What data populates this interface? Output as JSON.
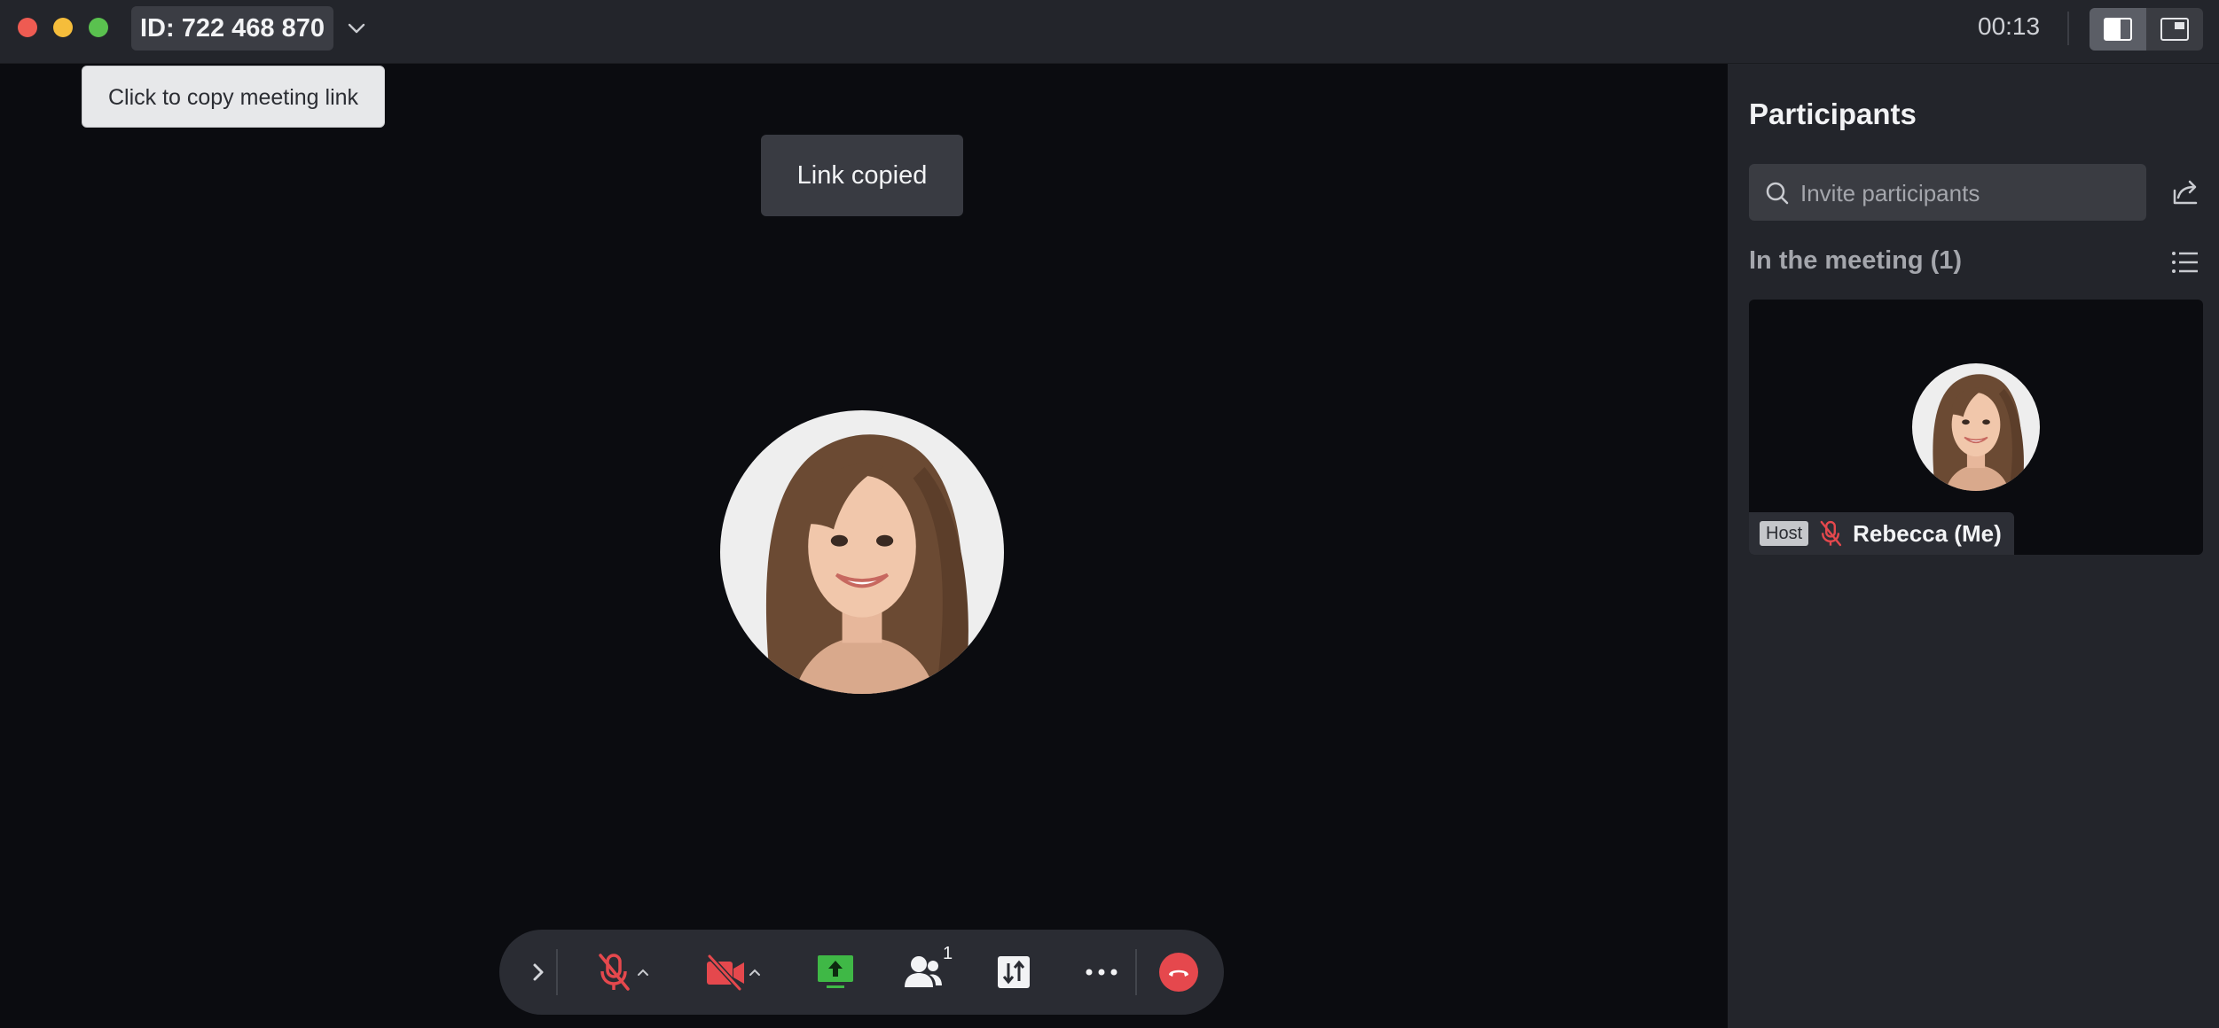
{
  "titlebar": {
    "meeting_id": "ID: 722 468 870",
    "timer": "00:13"
  },
  "tooltip": {
    "text": "Click to copy meeting link"
  },
  "toast": {
    "text": "Link copied"
  },
  "participants_panel": {
    "title": "Participants",
    "search_placeholder": "Invite participants",
    "section_title": "In the meeting (1)",
    "participants": [
      {
        "badge": "Host",
        "name": "Rebecca (Me)",
        "muted": true
      }
    ]
  },
  "controls": {
    "participant_count": "1"
  },
  "colors": {
    "accent_red": "#e5484d",
    "share_green": "#3fb846",
    "panel_bg": "#23252b",
    "stage_bg": "#0b0c10"
  }
}
